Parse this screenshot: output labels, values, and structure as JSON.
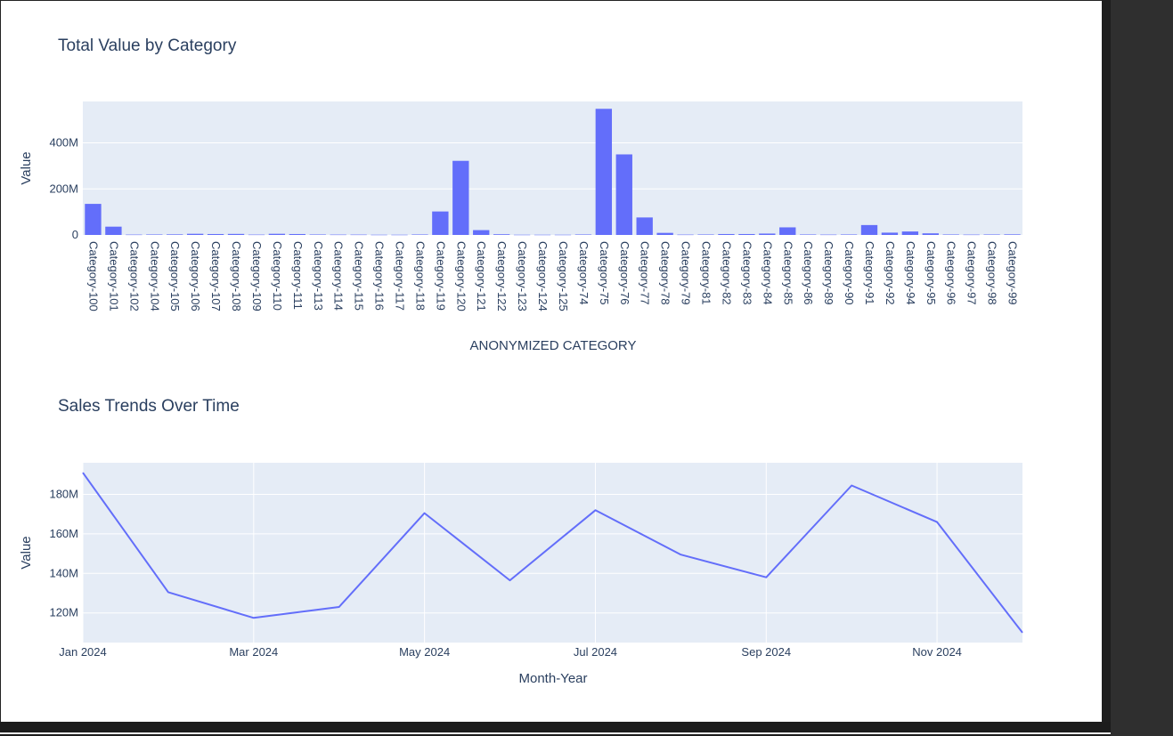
{
  "colors": {
    "plot_bg": "#e5ecf6",
    "grid": "#ffffff",
    "series": "#636efa",
    "text": "#2a3f5f",
    "tick_text": "#2a3f5f"
  },
  "chart_data": [
    {
      "type": "bar",
      "title": "Total Value by Category",
      "xlabel": "ANONYMIZED CATEGORY",
      "ylabel": "Value",
      "ylim": [
        0,
        580000000
      ],
      "yticks": [
        0,
        200000000,
        400000000
      ],
      "ytick_labels": [
        "0",
        "200M",
        "400M"
      ],
      "grid": true,
      "categories": [
        "Category-100",
        "Category-101",
        "Category-102",
        "Category-104",
        "Category-105",
        "Category-106",
        "Category-107",
        "Category-108",
        "Category-109",
        "Category-110",
        "Category-111",
        "Category-113",
        "Category-114",
        "Category-115",
        "Category-116",
        "Category-117",
        "Category-118",
        "Category-119",
        "Category-120",
        "Category-121",
        "Category-122",
        "Category-123",
        "Category-124",
        "Category-125",
        "Category-74",
        "Category-75",
        "Category-76",
        "Category-77",
        "Category-78",
        "Category-79",
        "Category-81",
        "Category-82",
        "Category-83",
        "Category-84",
        "Category-85",
        "Category-86",
        "Category-89",
        "Category-90",
        "Category-91",
        "Category-92",
        "Category-94",
        "Category-95",
        "Category-96",
        "Category-97",
        "Category-98",
        "Category-99"
      ],
      "values": [
        135000000,
        36000000,
        1500000,
        2000000,
        2500000,
        5000000,
        4000000,
        4500000,
        1500000,
        5000000,
        4000000,
        2000000,
        1500000,
        1500000,
        1000000,
        1000000,
        2000000,
        102000000,
        322000000,
        21000000,
        3000000,
        1000000,
        1000000,
        1000000,
        2000000,
        548000000,
        350000000,
        76000000,
        9000000,
        1500000,
        2000000,
        4000000,
        4000000,
        6000000,
        33000000,
        2000000,
        1500000,
        2000000,
        43000000,
        10000000,
        15000000,
        7000000,
        2000000,
        1500000,
        2000000,
        2500000
      ]
    },
    {
      "type": "line",
      "title": "Sales Trends Over Time",
      "xlabel": "Month-Year",
      "ylabel": "Value",
      "ylim": [
        105000000,
        196000000
      ],
      "yticks": [
        120000000,
        140000000,
        160000000,
        180000000
      ],
      "ytick_labels": [
        "120M",
        "140M",
        "160M",
        "180M"
      ],
      "grid": true,
      "x": [
        "2024-01",
        "2024-02",
        "2024-03",
        "2024-04",
        "2024-05",
        "2024-06",
        "2024-07",
        "2024-08",
        "2024-09",
        "2024-10",
        "2024-11",
        "2024-12"
      ],
      "xtick_positions": [
        "2024-01",
        "2024-03",
        "2024-05",
        "2024-07",
        "2024-09",
        "2024-11"
      ],
      "xtick_labels": [
        "Jan 2024",
        "Mar 2024",
        "May 2024",
        "Jul 2024",
        "Sep 2024",
        "Nov 2024"
      ],
      "values": [
        191000000,
        130500000,
        117500000,
        123000000,
        170500000,
        136500000,
        172000000,
        149500000,
        138000000,
        184500000,
        166000000,
        110000000
      ]
    }
  ]
}
